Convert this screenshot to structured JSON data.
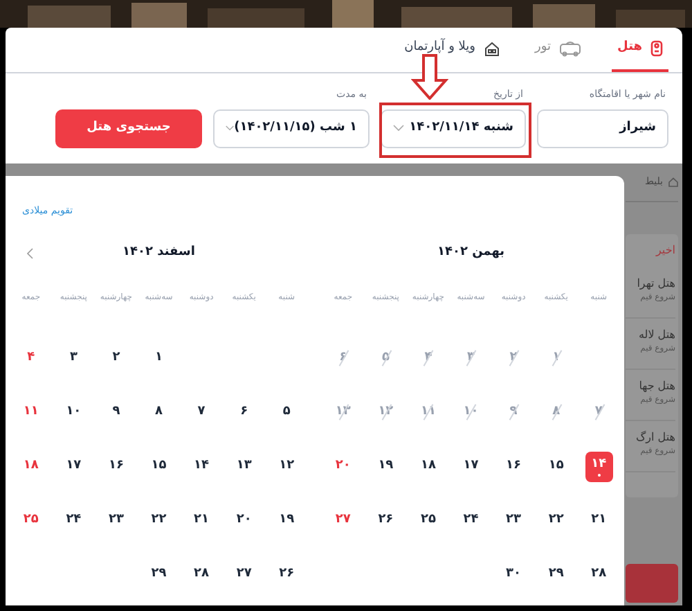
{
  "tabs": [
    {
      "label": "هتل",
      "selected": true,
      "disabled": false
    },
    {
      "label": "تور",
      "selected": false,
      "disabled": true
    },
    {
      "label": "ویلا و آپارتمان",
      "selected": false,
      "disabled": false
    }
  ],
  "search": {
    "fields": [
      {
        "label": "نام شهر یا اقامتگاه",
        "value": "شیراز",
        "kind": "text",
        "highlighted": false
      },
      {
        "label": "از تاریخ",
        "value": "شنبه ۱۴۰۲/۱۱/۱۴",
        "kind": "select",
        "highlighted": true
      },
      {
        "label": "به مدت",
        "value": "۱ شب (۱۴۰۲/۱۱/۱۵)",
        "kind": "select",
        "highlighted": false
      }
    ],
    "button": "جستجوی هتل"
  },
  "calendar": {
    "gregorian_link": "تقویم میلادی",
    "months": [
      {
        "title": "بهمن ۱۴۰۲",
        "next_button": false,
        "weekdays": [
          "شنبه",
          "یکشنبه",
          "دوشنبه",
          "سه‌شنبه",
          "چهارشنبه",
          "پنجشنبه",
          "جمعه"
        ],
        "days": [
          {
            "kind": "blank"
          },
          {
            "text": "۱",
            "disabled": true,
            "holiday": false,
            "selected": false
          },
          {
            "text": "۲",
            "disabled": true,
            "holiday": false,
            "selected": false
          },
          {
            "text": "۳",
            "disabled": true,
            "holiday": false,
            "selected": false
          },
          {
            "text": "۴",
            "disabled": true,
            "holiday": false,
            "selected": false
          },
          {
            "text": "۵",
            "disabled": true,
            "holiday": false,
            "selected": false
          },
          {
            "text": "۶",
            "disabled": true,
            "holiday": false,
            "selected": false
          },
          {
            "text": "۷",
            "disabled": true,
            "holiday": false,
            "selected": false
          },
          {
            "text": "۸",
            "disabled": true,
            "holiday": false,
            "selected": false
          },
          {
            "text": "۹",
            "disabled": true,
            "holiday": false,
            "selected": false
          },
          {
            "text": "۱۰",
            "disabled": true,
            "holiday": false,
            "selected": false
          },
          {
            "text": "۱۱",
            "disabled": true,
            "holiday": false,
            "selected": false
          },
          {
            "text": "۱۲",
            "disabled": true,
            "holiday": false,
            "selected": false
          },
          {
            "text": "۱۳",
            "disabled": true,
            "holiday": false,
            "selected": false
          },
          {
            "text": "۱۴",
            "disabled": false,
            "holiday": false,
            "selected": true
          },
          {
            "text": "۱۵",
            "disabled": false,
            "holiday": false,
            "selected": false
          },
          {
            "text": "۱۶",
            "disabled": false,
            "holiday": false,
            "selected": false
          },
          {
            "text": "۱۷",
            "disabled": false,
            "holiday": false,
            "selected": false
          },
          {
            "text": "۱۸",
            "disabled": false,
            "holiday": false,
            "selected": false
          },
          {
            "text": "۱۹",
            "disabled": false,
            "holiday": false,
            "selected": false
          },
          {
            "text": "۲۰",
            "disabled": false,
            "holiday": true,
            "selected": false
          },
          {
            "text": "۲۱",
            "disabled": false,
            "holiday": false,
            "selected": false
          },
          {
            "text": "۲۲",
            "disabled": false,
            "holiday": false,
            "selected": false
          },
          {
            "text": "۲۳",
            "disabled": false,
            "holiday": false,
            "selected": false
          },
          {
            "text": "۲۴",
            "disabled": false,
            "holiday": false,
            "selected": false
          },
          {
            "text": "۲۵",
            "disabled": false,
            "holiday": false,
            "selected": false
          },
          {
            "text": "۲۶",
            "disabled": false,
            "holiday": false,
            "selected": false
          },
          {
            "text": "۲۷",
            "disabled": false,
            "holiday": true,
            "selected": false
          },
          {
            "text": "۲۸",
            "disabled": false,
            "holiday": false,
            "selected": false
          },
          {
            "text": "۲۹",
            "disabled": false,
            "holiday": false,
            "selected": false
          },
          {
            "text": "۳۰",
            "disabled": false,
            "holiday": false,
            "selected": false
          }
        ]
      },
      {
        "title": "اسفند ۱۴۰۲",
        "next_button": true,
        "weekdays": [
          "شنبه",
          "یکشنبه",
          "دوشنبه",
          "سه‌شنبه",
          "چهارشنبه",
          "پنجشنبه",
          "جمعه"
        ],
        "days": [
          {
            "kind": "blank"
          },
          {
            "kind": "blank"
          },
          {
            "kind": "blank"
          },
          {
            "text": "۱",
            "disabled": false,
            "holiday": false,
            "selected": false
          },
          {
            "text": "۲",
            "disabled": false,
            "holiday": false,
            "selected": false
          },
          {
            "text": "۳",
            "disabled": false,
            "holiday": false,
            "selected": false
          },
          {
            "text": "۴",
            "disabled": false,
            "holiday": true,
            "selected": false
          },
          {
            "text": "۵",
            "disabled": false,
            "holiday": false,
            "selected": false
          },
          {
            "text": "۶",
            "disabled": false,
            "holiday": false,
            "selected": false
          },
          {
            "text": "۷",
            "disabled": false,
            "holiday": false,
            "selected": false
          },
          {
            "text": "۸",
            "disabled": false,
            "holiday": false,
            "selected": false
          },
          {
            "text": "۹",
            "disabled": false,
            "holiday": false,
            "selected": false
          },
          {
            "text": "۱۰",
            "disabled": false,
            "holiday": false,
            "selected": false
          },
          {
            "text": "۱۱",
            "disabled": false,
            "holiday": true,
            "selected": false
          },
          {
            "text": "۱۲",
            "disabled": false,
            "holiday": false,
            "selected": false
          },
          {
            "text": "۱۳",
            "disabled": false,
            "holiday": false,
            "selected": false
          },
          {
            "text": "۱۴",
            "disabled": false,
            "holiday": false,
            "selected": false
          },
          {
            "text": "۱۵",
            "disabled": false,
            "holiday": false,
            "selected": false
          },
          {
            "text": "۱۶",
            "disabled": false,
            "holiday": false,
            "selected": false
          },
          {
            "text": "۱۷",
            "disabled": false,
            "holiday": false,
            "selected": false
          },
          {
            "text": "۱۸",
            "disabled": false,
            "holiday": true,
            "selected": false
          },
          {
            "text": "۱۹",
            "disabled": false,
            "holiday": false,
            "selected": false
          },
          {
            "text": "۲۰",
            "disabled": false,
            "holiday": false,
            "selected": false
          },
          {
            "text": "۲۱",
            "disabled": false,
            "holiday": false,
            "selected": false
          },
          {
            "text": "۲۲",
            "disabled": false,
            "holiday": false,
            "selected": false
          },
          {
            "text": "۲۳",
            "disabled": false,
            "holiday": false,
            "selected": false
          },
          {
            "text": "۲۴",
            "disabled": false,
            "holiday": false,
            "selected": false
          },
          {
            "text": "۲۵",
            "disabled": false,
            "holiday": true,
            "selected": false
          },
          {
            "text": "۲۶",
            "disabled": false,
            "holiday": false,
            "selected": false
          },
          {
            "text": "۲۷",
            "disabled": false,
            "holiday": false,
            "selected": false
          },
          {
            "text": "۲۸",
            "disabled": false,
            "holiday": false,
            "selected": false
          },
          {
            "text": "۲۹",
            "disabled": false,
            "holiday": false,
            "selected": false
          }
        ]
      }
    ]
  },
  "sidebar": {
    "breadcrumb": "بلیط",
    "recent_title": "اخیر",
    "hotels": [
      {
        "name": "هتل تهرا",
        "note": "شروع قیم"
      },
      {
        "name": "هتل لاله",
        "note": "شروع قیم"
      },
      {
        "name": "هتل جها",
        "note": "شروع قیم"
      },
      {
        "name": "هتل ارگ",
        "note": "شروع قیم"
      }
    ]
  }
}
